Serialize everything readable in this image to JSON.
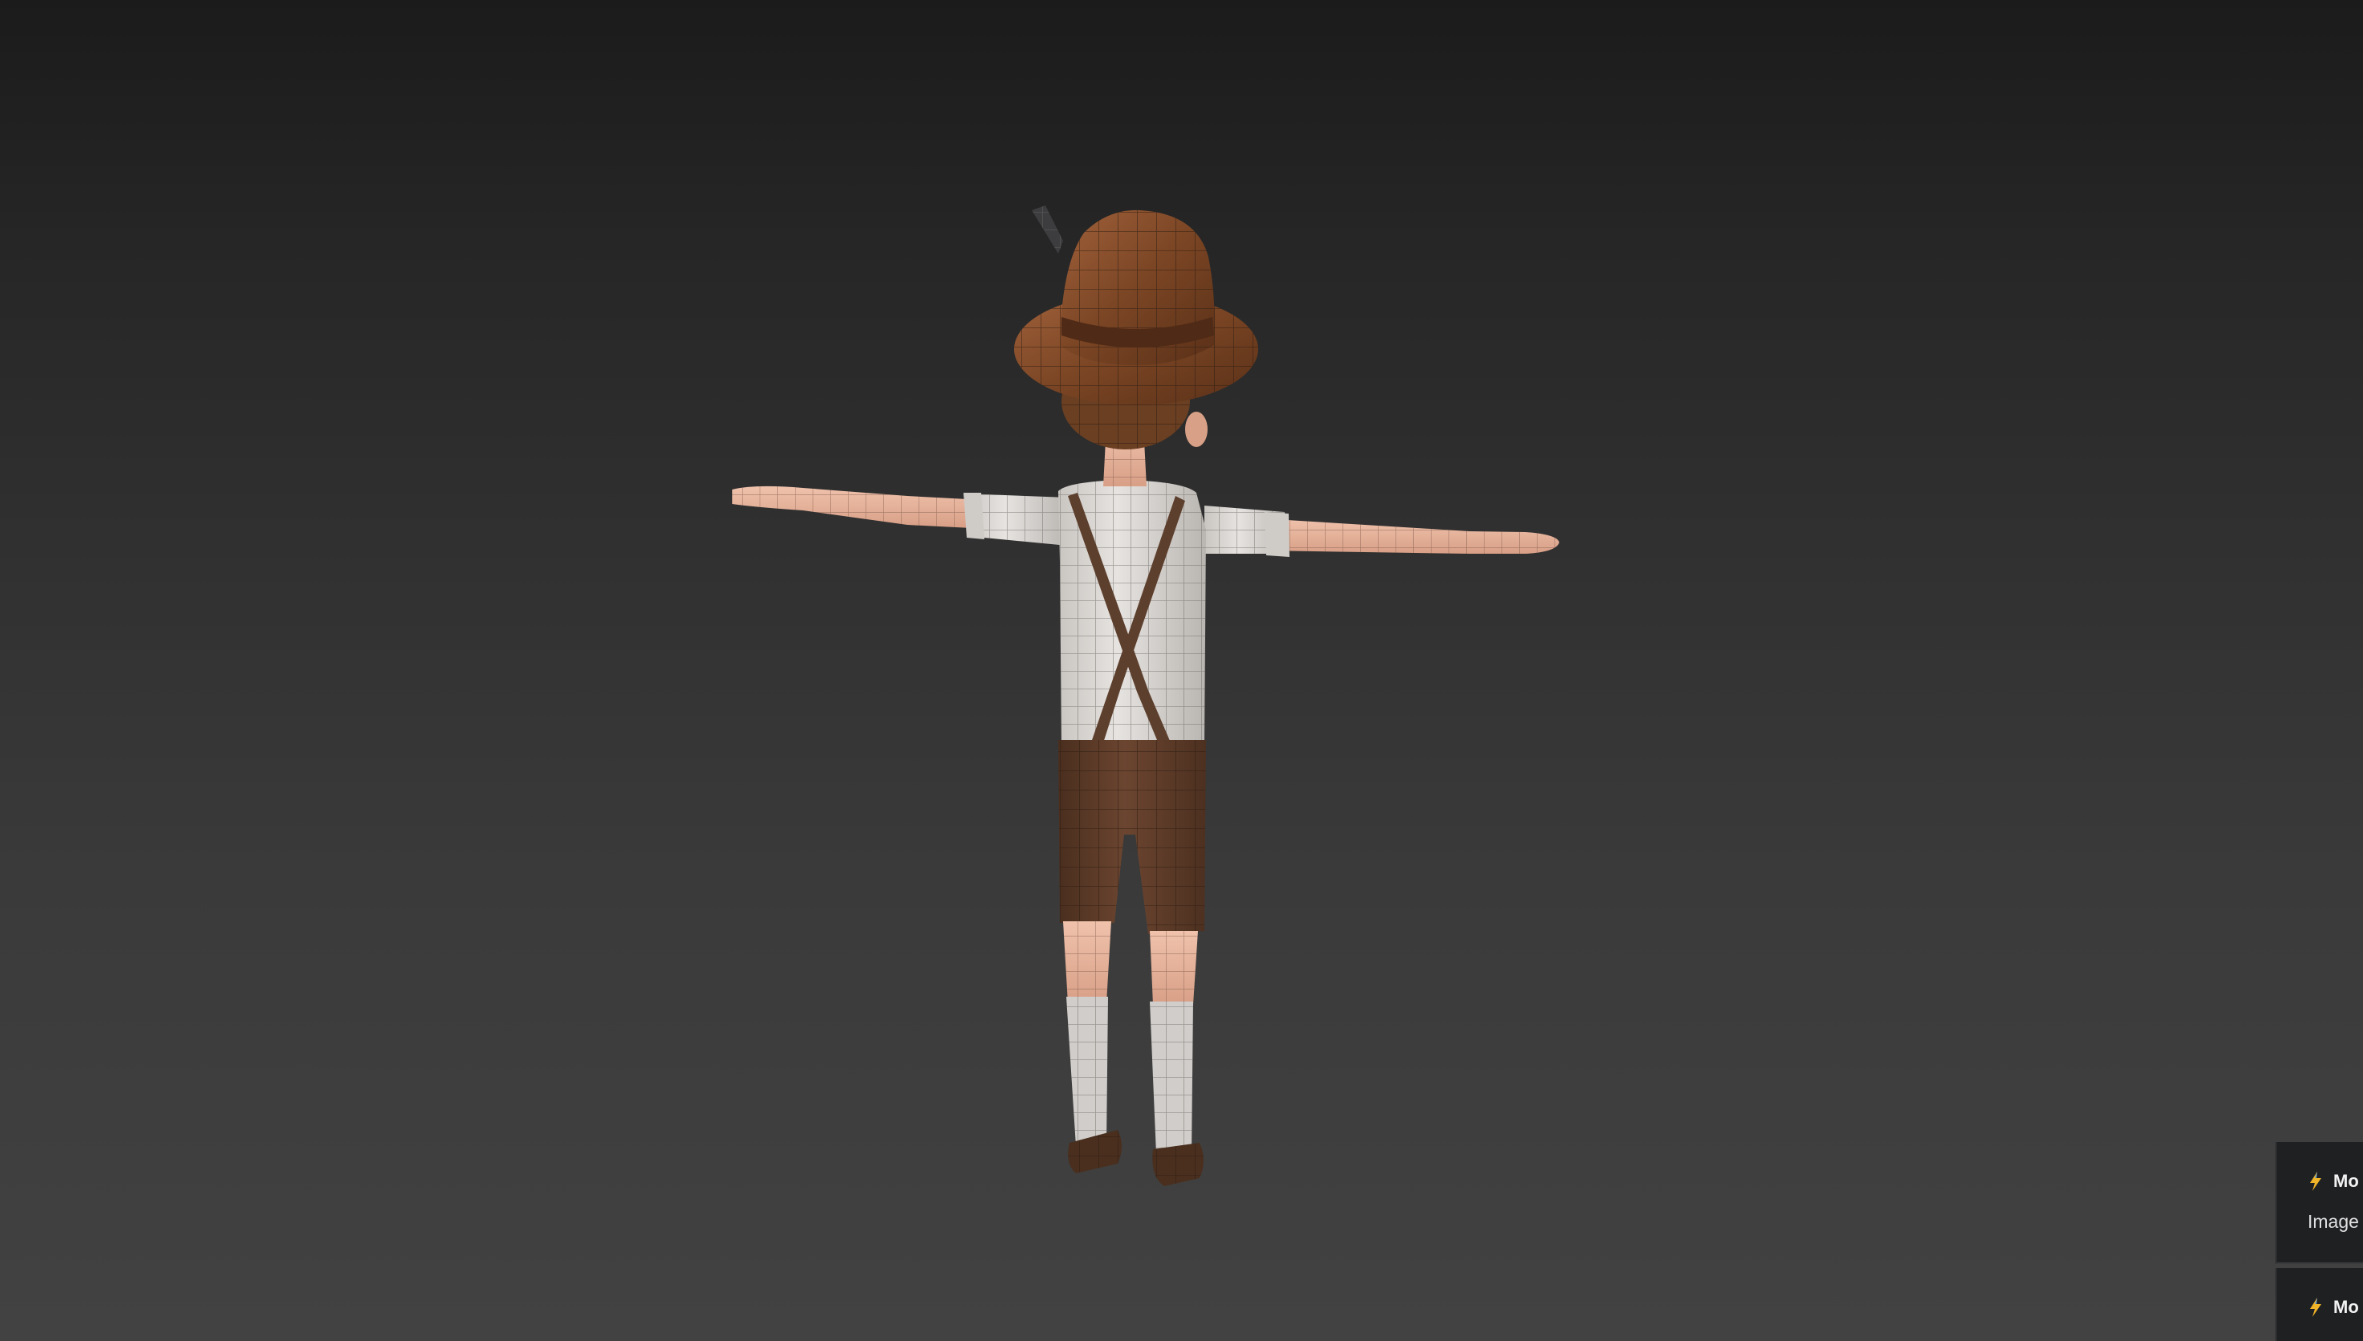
{
  "viewport": {
    "background_top": "#1b1b1b",
    "background_bottom": "#424242",
    "model": {
      "description_icon": "character-model",
      "colors": {
        "hat": "#7a4524",
        "shirt": "#d9d6d3",
        "skin": "#e7b39b",
        "shorts": "#5b3a26",
        "socks": "#d0cdca",
        "shoes": "#4a2f1e",
        "hair": "#6b3f22",
        "wire": "#1e1a18"
      }
    }
  },
  "notifications": [
    {
      "icon": "lightning-icon",
      "title": "Mo",
      "body": "Image c"
    },
    {
      "icon": "lightning-icon",
      "title": "Mo",
      "body": ""
    }
  ]
}
